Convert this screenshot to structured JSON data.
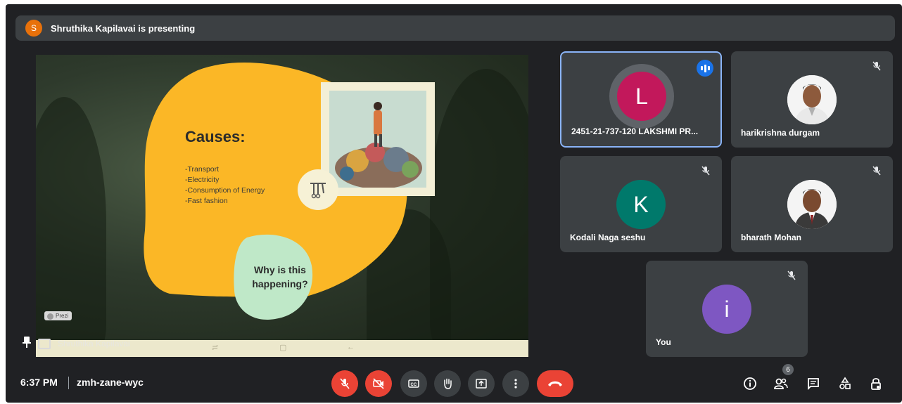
{
  "banner": {
    "avatar_letter": "S",
    "text": "Shruthika Kapilavai is presenting"
  },
  "slide": {
    "title": "Causes:",
    "list": [
      "-Transport",
      "-Electricity",
      "-Consumption of Energy",
      "-Fast fashion"
    ],
    "bubble_line1": "Why is this",
    "bubble_line2": "happening?",
    "prezi_label": "Prezi"
  },
  "presenter": {
    "name": "Shruthika Kapilavai"
  },
  "tiles": [
    {
      "name": "2451-21-737-120 LAKSHMI PR...",
      "letter": "L",
      "color": "#c2185b",
      "speaking": true
    },
    {
      "name": "harikrishna durgam",
      "muted": true
    },
    {
      "name": "Kodali Naga seshu",
      "letter": "K",
      "color": "#00796b",
      "muted": true
    },
    {
      "name": "bharath Mohan",
      "muted": true
    },
    {
      "name": "You",
      "letter": "i",
      "color": "#7e57c2",
      "muted": true
    }
  ],
  "bottom": {
    "time": "6:37 PM",
    "meeting_code": "zmh-zane-wyc",
    "participant_count": "6"
  },
  "colors": {
    "accent": "#8ab4f8",
    "danger": "#ea4335",
    "blob": "#fbb726",
    "bubble": "#bfe8c8"
  },
  "icons": [
    "mic-off-icon",
    "camera-off-icon",
    "captions-icon",
    "raise-hand-icon",
    "present-icon",
    "more-icon",
    "hangup-icon",
    "info-icon",
    "people-icon",
    "chat-icon",
    "activities-icon",
    "host-controls-icon"
  ]
}
